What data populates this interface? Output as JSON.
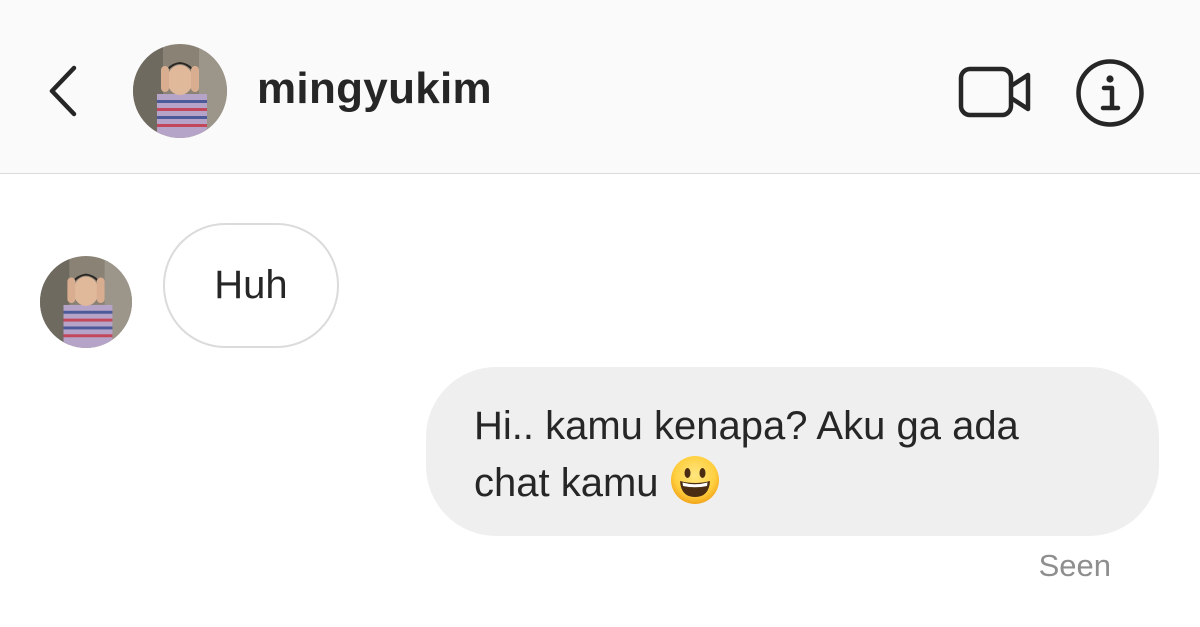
{
  "header": {
    "back_icon": "chevron-left-icon",
    "username": "mingyukim",
    "video_call_icon": "video-camera-icon",
    "info_icon": "info-icon",
    "background": "#fafafa"
  },
  "messages": [
    {
      "direction": "incoming",
      "text": "Huh"
    },
    {
      "direction": "outgoing",
      "line1": "Hi.. kamu kenapa? Aku ga ada",
      "line2": "chat kamu",
      "emoji": "grinning-face-emoji"
    }
  ],
  "status": {
    "seen": "Seen"
  },
  "colors": {
    "text": "#262626",
    "muted": "#8e8e8e",
    "outgoing_bubble": "#efefef",
    "incoming_border": "#dbdbdb"
  }
}
